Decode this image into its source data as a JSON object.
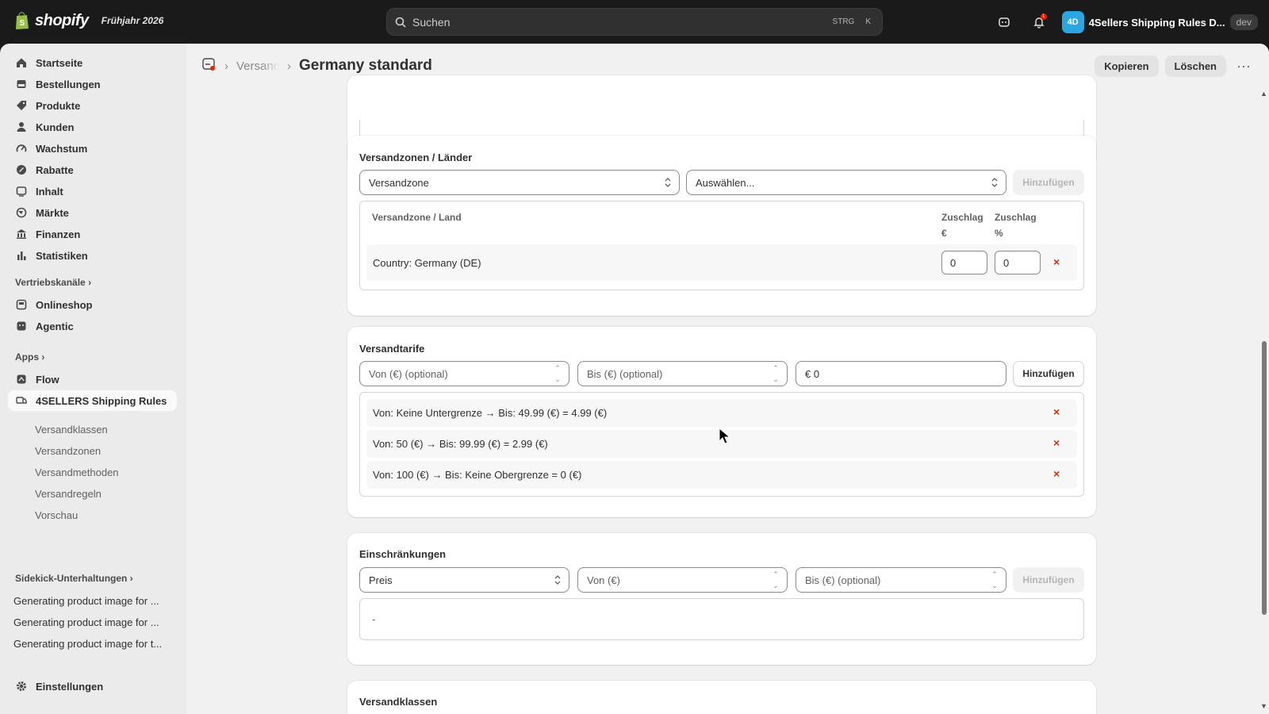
{
  "topbar": {
    "wordmark": "shopify",
    "edition": "Frühjahr 2026",
    "search_placeholder": "Suchen",
    "shortcut_1": "STRG",
    "shortcut_2": "K",
    "notification_count": "1",
    "store_initials": "4D",
    "store_name": "4Sellers Shipping Rules D...",
    "store_badge": "dev"
  },
  "sidebar": {
    "items": [
      {
        "label": "Startseite",
        "icon": "home-icon"
      },
      {
        "label": "Bestellungen",
        "icon": "orders-icon"
      },
      {
        "label": "Produkte",
        "icon": "tag-icon"
      },
      {
        "label": "Kunden",
        "icon": "person-icon"
      },
      {
        "label": "Wachstum",
        "icon": "gauge-icon"
      },
      {
        "label": "Rabatte",
        "icon": "discount-icon"
      },
      {
        "label": "Inhalt",
        "icon": "content-icon"
      },
      {
        "label": "Märkte",
        "icon": "globe-icon"
      },
      {
        "label": "Finanzen",
        "icon": "bank-icon"
      },
      {
        "label": "Statistiken",
        "icon": "bar-chart-icon"
      }
    ],
    "sales_channels_label": "Vertriebskanäle",
    "sales_channels": [
      {
        "label": "Onlineshop",
        "icon": "store-icon"
      },
      {
        "label": "Agentic",
        "icon": "agent-icon"
      }
    ],
    "apps_label": "Apps",
    "apps": [
      {
        "label": "Flow",
        "icon": "flow-icon"
      },
      {
        "label": "4SELLERS Shipping Rules",
        "icon": "shipping-app-icon"
      }
    ],
    "app_subitems": [
      "Versandklassen",
      "Versandzonen",
      "Versandmethoden",
      "Versandregeln",
      "Vorschau"
    ],
    "sidekick_label": "Sidekick-Unterhaltungen",
    "chats": [
      "Generating product image for ...",
      "Generating product image for ...",
      "Generating product image for t..."
    ],
    "settings_label": "Einstellungen"
  },
  "header": {
    "breadcrumb_parent": "Versand",
    "title": "Germany standard",
    "copy_label": "Kopieren",
    "delete_label": "Löschen",
    "more_label": "···"
  },
  "zones": {
    "heading": "Versandzonen / Länder",
    "type_select": "Versandzone",
    "value_select": "Auswählen...",
    "add_label": "Hinzufügen",
    "col_zone": "Versandzone / Land",
    "col_surcharge_eur_1": "Zuschlag",
    "col_surcharge_eur_2": "€",
    "col_surcharge_pct_1": "Zuschlag",
    "col_surcharge_pct_2": "%",
    "row_label": "Country: Germany (DE)",
    "row_surcharge_eur": "0",
    "row_surcharge_pct": "0",
    "remove_symbol": "×"
  },
  "rates": {
    "heading": "Versandtarife",
    "from_placeholder": "Von (€) (optional)",
    "to_placeholder": "Bis (€) (optional)",
    "price_value": "€ 0",
    "add_label": "Hinzufügen",
    "rows": [
      "Von: Keine Untergrenze → Bis: 49.99 (€) = 4.99 (€)",
      "Von: 50 (€) → Bis: 99.99 (€) = 2.99 (€)",
      "Von: 100 (€) → Bis: Keine Obergrenze = 0 (€)"
    ],
    "remove_symbol": "×"
  },
  "restrictions": {
    "heading": "Einschränkungen",
    "type_select": "Preis",
    "from_placeholder": "Von (€)",
    "to_placeholder": "Bis (€) (optional)",
    "add_label": "Hinzufügen",
    "empty_text": "-"
  },
  "classes": {
    "heading": "Versandklassen"
  }
}
